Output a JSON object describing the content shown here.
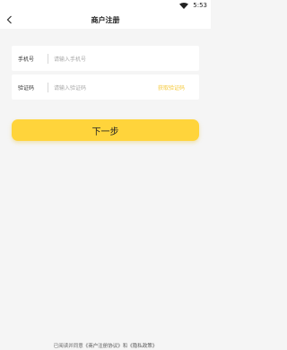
{
  "status_bar": {
    "time": "5:53"
  },
  "header": {
    "title": "商户注册"
  },
  "form": {
    "phone": {
      "label": "手机号",
      "placeholder": "请输入手机号"
    },
    "code": {
      "label": "验证码",
      "placeholder": "请输入验证码",
      "send_label": "获取验证码"
    }
  },
  "next_button": {
    "label": "下一步"
  },
  "agreement": {
    "prefix": "已阅读并同意",
    "link1": "《商户注册协议》",
    "middle": "和",
    "link2": "《隐私政策》"
  },
  "colors": {
    "accent": "#ffd43b",
    "code_link": "#f5c93b",
    "background": "#f5f5f5"
  }
}
